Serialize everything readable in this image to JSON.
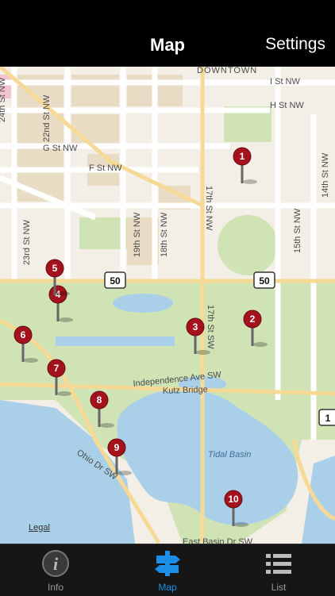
{
  "navbar": {
    "title": "Map",
    "settings_label": "Settings"
  },
  "map": {
    "legal_label": "Legal",
    "street_labels": {
      "downtown": "DOWNTOWN",
      "i_st": "I St NW",
      "h_st": "H St NW",
      "g_st": "G St NW",
      "f_st": "F St NW",
      "st22": "22nd St NW",
      "st23": "23rd St NW",
      "st17": "17th St NW",
      "st17sw": "17th St SW",
      "st19": "19th St NW",
      "st18": "18th St NW",
      "st15": "15th St NW",
      "st14": "14th St NW",
      "st24": "24th St NW",
      "independence": "Independence Ave SW",
      "kutz": "Kutz Bridge",
      "ohio": "Ohio Dr SW",
      "tidal": "Tidal Basin",
      "east_basin": "East Basin Dr SW",
      "route50": "50",
      "route1": "1"
    },
    "pins": [
      "1",
      "2",
      "3",
      "4",
      "5",
      "6",
      "7",
      "8",
      "9",
      "10"
    ]
  },
  "tabbar": {
    "items": [
      {
        "label": "Info",
        "icon": "info-icon"
      },
      {
        "label": "Map",
        "icon": "signpost-icon"
      },
      {
        "label": "List",
        "icon": "list-icon"
      }
    ],
    "active_index": 1
  },
  "colors": {
    "accent": "#1c8ee6",
    "park": "#cfe3b5",
    "water": "#a9cfe9",
    "road": "#ffffff",
    "major_road": "#f7d996",
    "pin": "#a4121e"
  }
}
